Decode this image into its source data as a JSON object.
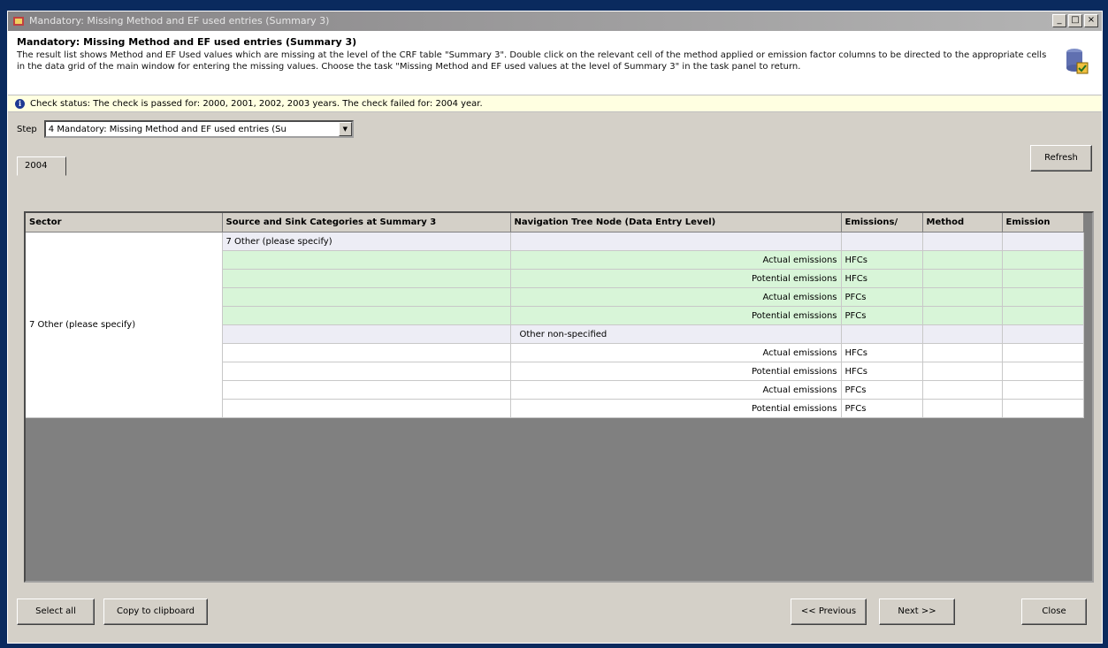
{
  "window": {
    "title": "Mandatory: Missing Method and EF used entries (Summary 3)",
    "buttons": {
      "minimize": "_",
      "maximize": "□",
      "close": "×"
    }
  },
  "header": {
    "title": "Mandatory: Missing Method and EF used entries (Summary 3)",
    "description": "The result list shows Method and EF Used values which are missing at the level of the CRF table \"Summary 3\". Double click on the relevant cell of the method applied or emission factor columns to be directed to the appropriate cells in the data grid of the main window for entering the missing values. Choose the task \"Missing Method and EF used values at the level of Summary 3\" in the task panel to return."
  },
  "status": {
    "text": "Check status: The check is passed for: 2000, 2001, 2002, 2003 years.   The check failed for: 2004 year."
  },
  "step": {
    "label": "Step",
    "value": "4 Mandatory: Missing Method and EF used entries (Su"
  },
  "refresh_label": "Refresh",
  "tabs": [
    "2004"
  ],
  "grid": {
    "columns": [
      "Sector",
      "Source and Sink Categories at Summary 3",
      "Navigation Tree Node (Data Entry Level)",
      "Emissions/",
      "Method",
      "Emission"
    ],
    "sector": "7 Other (please specify)",
    "rows": [
      {
        "cat": "7 Other (please specify)",
        "nav": "",
        "em": "",
        "style": "grp"
      },
      {
        "cat": "",
        "nav": "Actual emissions",
        "em": "HFCs",
        "style": "green"
      },
      {
        "cat": "",
        "nav": "Potential emissions",
        "em": "HFCs",
        "style": "green"
      },
      {
        "cat": "",
        "nav": "Actual emissions",
        "em": "PFCs",
        "style": "green"
      },
      {
        "cat": "",
        "nav": "Potential emissions",
        "em": "PFCs",
        "style": "green"
      },
      {
        "cat": "",
        "nav": "Other non-specified",
        "em": "",
        "style": "grp"
      },
      {
        "cat": "",
        "nav": "Actual emissions",
        "em": "HFCs",
        "style": "white"
      },
      {
        "cat": "",
        "nav": "Potential emissions",
        "em": "HFCs",
        "style": "white"
      },
      {
        "cat": "",
        "nav": "Actual emissions",
        "em": "PFCs",
        "style": "white"
      },
      {
        "cat": "",
        "nav": "Potential emissions",
        "em": "PFCs",
        "style": "white"
      }
    ]
  },
  "footer": {
    "select_all": "Select all",
    "copy": "Copy to clipboard",
    "previous": "<< Previous",
    "next": "Next >>",
    "close": "Close"
  }
}
